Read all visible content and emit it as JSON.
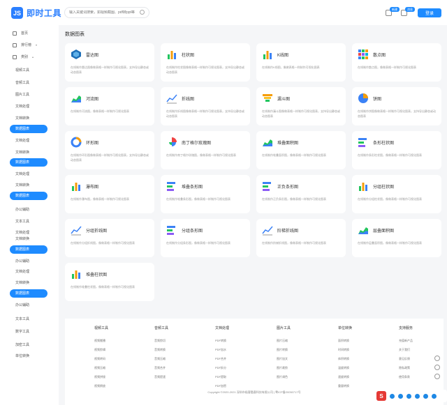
{
  "header": {
    "logo_text": "即时工具",
    "search_placeholder": "输入关键词搜索，如视频截图、pdf转ppt等",
    "badge_1": "新建",
    "badge_2": "消息",
    "login_label": "登录"
  },
  "sidebar": {
    "home": "首页",
    "ranking": "排行榜",
    "category": "类别",
    "items": [
      {
        "label": "视频工具",
        "active": false
      },
      {
        "label": "音频工具",
        "active": false
      },
      {
        "label": "图片工具",
        "active": false
      },
      {
        "label": "文档处理",
        "active": false
      },
      {
        "label": "文档转换",
        "active": false
      },
      {
        "label": "数据图表",
        "active": true
      },
      {
        "label": "文档处理",
        "active": false
      },
      {
        "label": "文档转换",
        "active": false
      },
      {
        "label": "数据图表",
        "active": true
      },
      {
        "label": "文档处理",
        "active": false
      },
      {
        "label": "文档转换",
        "active": false
      },
      {
        "label": "数据图表",
        "active": true
      },
      {
        "label": "办公辅助",
        "active": false
      },
      {
        "label": "文本工具",
        "active": false
      },
      {
        "label": "文档处理",
        "active": false
      },
      {
        "label": "文档转换",
        "active": false
      },
      {
        "label": "数据图表",
        "active": true
      },
      {
        "label": "办公辅助",
        "active": false
      },
      {
        "label": "文档处理",
        "active": false
      },
      {
        "label": "文档转换",
        "active": false
      },
      {
        "label": "数据图表",
        "active": true
      },
      {
        "label": "办公辅助",
        "active": false
      },
      {
        "label": "文本工具",
        "active": false
      },
      {
        "label": "数字工具",
        "active": false
      },
      {
        "label": "加密工具",
        "active": false
      },
      {
        "label": "单位转换",
        "active": false
      }
    ]
  },
  "section_title": "数据图表",
  "cards": [
    {
      "title": "雷达图",
      "desc": "在线制作雷达图像做表格一样制作可视化图表，支持导出静态或动态图表",
      "icon": "radar-chart-icon"
    },
    {
      "title": "柱状图",
      "desc": "在线制作柱状图像做表格一样制作可视化图表，支持导出静态或动态图表",
      "icon": "bar-chart-icon"
    },
    {
      "title": "K线图",
      "desc": "在线制作K线图，像做表格一样制作可视化图表",
      "icon": "candlestick-chart-icon"
    },
    {
      "title": "散点图",
      "desc": "在线制作散点图，像做表格一样制作可视化图表",
      "icon": "scatter-chart-icon"
    },
    {
      "title": "河流图",
      "desc": "在线制作河流图，像做表格一样制作可视化图表",
      "icon": "river-chart-icon"
    },
    {
      "title": "折线图",
      "desc": "在线制作折线图像做表格一样制作可视化图表，支持导出静态或动态图表",
      "icon": "line-chart-icon"
    },
    {
      "title": "漏斗图",
      "desc": "在线制作漏斗图像做表格一样制作可视化图表，支持导出静态或动态图表",
      "icon": "funnel-chart-icon"
    },
    {
      "title": "饼图",
      "desc": "在线制作饼图像做表格一样制作可视化图表，支持导出静态或动态图表",
      "icon": "pie-chart-icon"
    },
    {
      "title": "环形图",
      "desc": "在线制作环形图像做表格一样制作可视化图表，支持导出静态或动态图表",
      "icon": "donut-chart-icon"
    },
    {
      "title": "南丁格尔玫瑰图",
      "desc": "在线制作南丁格尔玫瑰图，像做表格一样制作可视化图表",
      "icon": "rose-chart-icon"
    },
    {
      "title": "堆叠面积图",
      "desc": "在线制作堆叠面积图，像做表格一样制作可视化图表",
      "icon": "stacked-area-chart-icon"
    },
    {
      "title": "条形柱状图",
      "desc": "在线制作条形柱状图，像做表格一样制作可视化图表",
      "icon": "horizontal-bar-chart-icon"
    },
    {
      "title": "瀑布图",
      "desc": "在线制作瀑布图，像做表格一样制作可视化图表",
      "icon": "waterfall-chart-icon"
    },
    {
      "title": "堆叠条形图",
      "desc": "在线制作堆叠条形图，像做表格一样制作可视化图表",
      "icon": "stacked-bar-chart-icon"
    },
    {
      "title": "正负条形图",
      "desc": "在线制作正负条形图，像做表格一样制作可视化图表",
      "icon": "diverging-bar-chart-icon"
    },
    {
      "title": "分组柱状图",
      "desc": "在线制作分组柱状图，像做表格一样制作可视化图表",
      "icon": "grouped-bar-chart-icon"
    },
    {
      "title": "分组折线图",
      "desc": "在线制作分组折线图，像做表格一样制作可视化图表",
      "icon": "grouped-line-chart-icon"
    },
    {
      "title": "分组条形图",
      "desc": "在线制作分组条形图，像做表格一样制作可视化图表",
      "icon": "grouped-horizontal-bar-icon"
    },
    {
      "title": "阶梯折线图",
      "desc": "在线制作阶梯折线图，像做表格一样制作可视化图表",
      "icon": "step-line-chart-icon"
    },
    {
      "title": "层叠面积图",
      "desc": "在线制作层叠面积图，像做表格一样制作可视化图表",
      "icon": "layered-area-chart-icon"
    },
    {
      "title": "堆叠柱状图",
      "desc": "在线制作堆叠柱状图，像做表格一样制作可视化图表",
      "icon": "stacked-column-chart-icon"
    }
  ],
  "footer": {
    "columns": [
      {
        "head": "视频工具",
        "links": [
          "视频搬播",
          "视频剪辑",
          "视频转码",
          "视频压缩",
          "视频拼接",
          "视频倒放"
        ]
      },
      {
        "head": "音频工具",
        "links": [
          "音频剪切",
          "音频转换",
          "音频压缩",
          "音频合并",
          "音频提速"
        ]
      },
      {
        "head": "文档处理",
        "links": [
          "PDF转换",
          "PDF加水",
          "PDF合并",
          "PDF拆分",
          "PDF提取",
          "PDF加密"
        ]
      },
      {
        "head": "图片工具",
        "links": [
          "图片压缩",
          "图片转换",
          "图片加文",
          "图片裁剪",
          "图片调色"
        ]
      },
      {
        "head": "单位转换",
        "links": [
          "面积转换",
          "时间转换",
          "体积转换",
          "温度转换",
          "速度转换",
          "重量转换"
        ]
      },
      {
        "head": "支持服务",
        "links": [
          "充值新产品",
          "关于我们",
          "意见反馈",
          "隐私政策",
          "使用条款"
        ]
      }
    ],
    "copyright": "Copyright ©2020-2021 深圳市极客酷客科技有限公司 | 粤ICP备20050717号"
  },
  "ime_logo": "S"
}
